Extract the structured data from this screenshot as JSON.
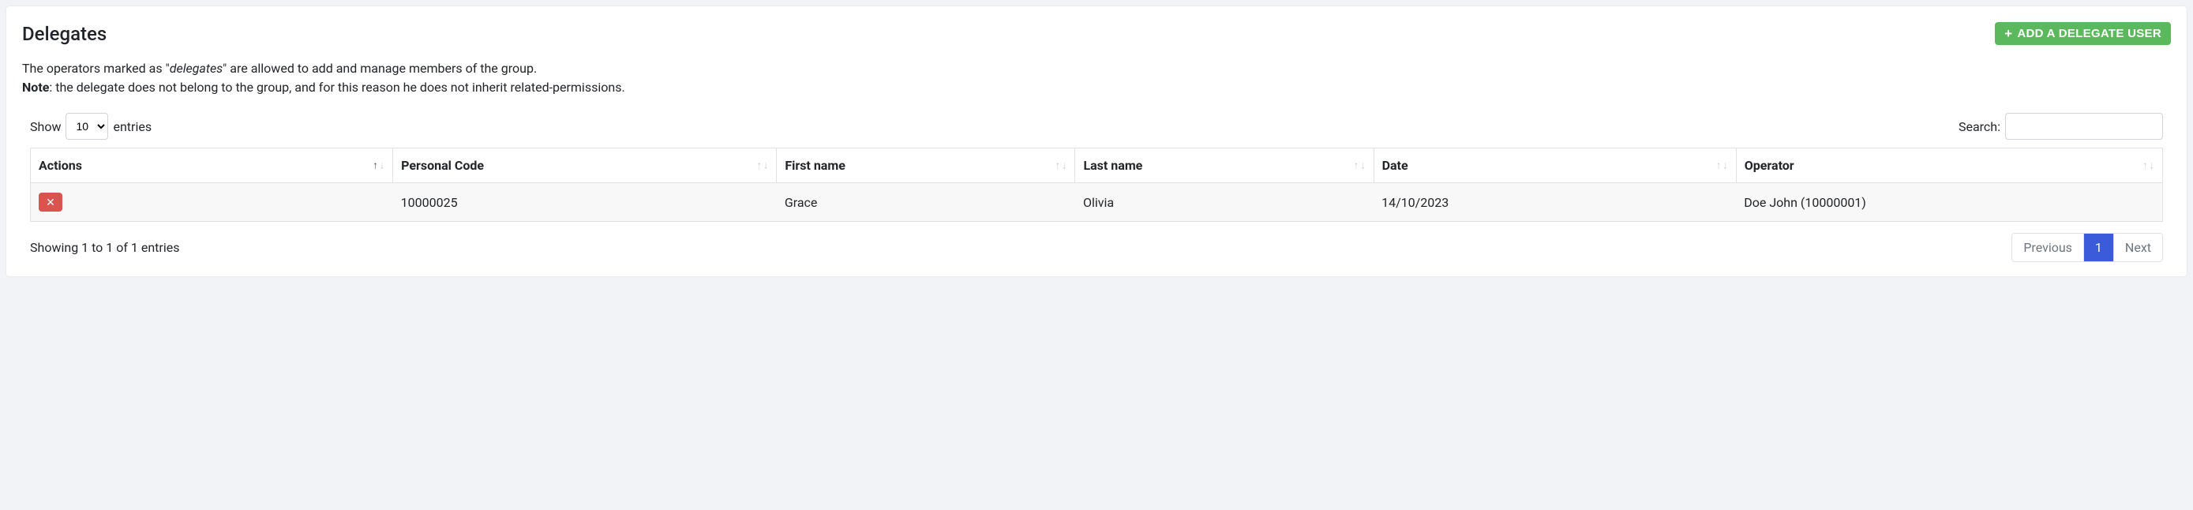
{
  "header": {
    "title": "Delegates",
    "add_button_label": "ADD A DELEGATE USER"
  },
  "intro": {
    "line1_pre": "The operators marked as \"",
    "line1_em": "delegates",
    "line1_post": "\" are allowed to add and manage members of the group.",
    "line2_strong": "Note",
    "line2_rest": ": the delegate does not belong to the group, and for this reason he does not inherit related-permissions."
  },
  "controls": {
    "show_label": "Show",
    "entries_label": "entries",
    "page_size": "10",
    "search_label": "Search:"
  },
  "table": {
    "headers": {
      "actions": "Actions",
      "personal_code": "Personal Code",
      "first_name": "First name",
      "last_name": "Last name",
      "date": "Date",
      "operator": "Operator"
    },
    "rows": [
      {
        "personal_code": "10000025",
        "first_name": "Grace",
        "last_name": "Olivia",
        "date": "14/10/2023",
        "operator": "Doe John (10000001)"
      }
    ]
  },
  "footer": {
    "info": "Showing 1 to 1 of 1 entries",
    "previous_label": "Previous",
    "page_number": "1",
    "next_label": "Next"
  }
}
